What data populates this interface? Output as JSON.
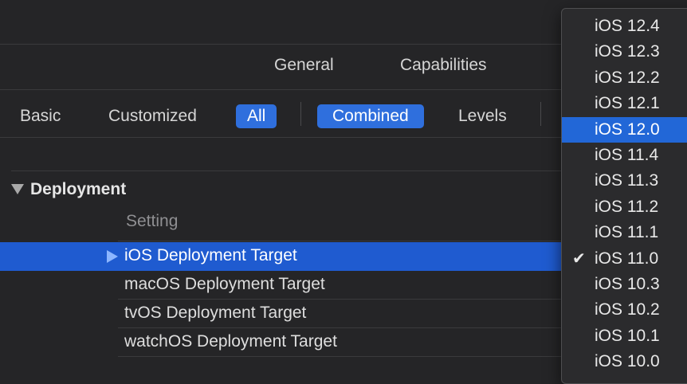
{
  "tabs": {
    "general": "General",
    "capabilities": "Capabilities"
  },
  "filters": {
    "basic": "Basic",
    "customized": "Customized",
    "all": "All",
    "combined": "Combined",
    "levels": "Levels"
  },
  "section": {
    "title": "Deployment",
    "column_header": "Setting",
    "rows": [
      {
        "label": "iOS Deployment Target",
        "selected": true
      },
      {
        "label": "macOS Deployment Target"
      },
      {
        "label": "tvOS Deployment Target"
      },
      {
        "label": "watchOS Deployment Target"
      }
    ]
  },
  "version_menu": {
    "items": [
      "iOS 12.4",
      "iOS 12.3",
      "iOS 12.2",
      "iOS 12.1",
      "iOS 12.0",
      "iOS 11.4",
      "iOS 11.3",
      "iOS 11.2",
      "iOS 11.1",
      "iOS 11.0",
      "iOS 10.3",
      "iOS 10.2",
      "iOS 10.1",
      "iOS 10.0"
    ],
    "highlighted": "iOS 12.0",
    "checked": "iOS 11.0",
    "check_icon": "checkmark-icon"
  },
  "colors": {
    "background": "#252527",
    "selection": "#1f5bd0",
    "accent_pill": "#2f6fdd",
    "menu_highlight": "#2267d7"
  }
}
